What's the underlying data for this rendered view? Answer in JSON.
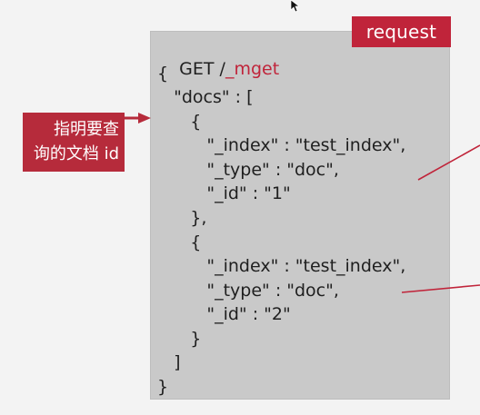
{
  "badge": {
    "request_label": "request"
  },
  "callout": {
    "line1": "指明要查",
    "line2": "询的文档 id"
  },
  "code": {
    "method": "GET /",
    "endpoint": "_mget",
    "lines": [
      "{",
      "   \"docs\" : [",
      "      {",
      "         \"_index\" : \"test_index\",",
      "         \"_type\" : \"doc\",",
      "         \"_id\" : \"1\"",
      "      },",
      "      {",
      "         \"_index\" : \"test_index\",",
      "         \"_type\" : \"doc\",",
      "         \"_id\" : \"2\"",
      "      }",
      "   ]",
      "}"
    ]
  },
  "colors": {
    "accent": "#c0243a",
    "panel": "#c9c9c9",
    "background": "#f3f3f3"
  },
  "icons": {
    "cursor": "mouse-pointer-icon",
    "arrow": "right-arrow-icon"
  }
}
